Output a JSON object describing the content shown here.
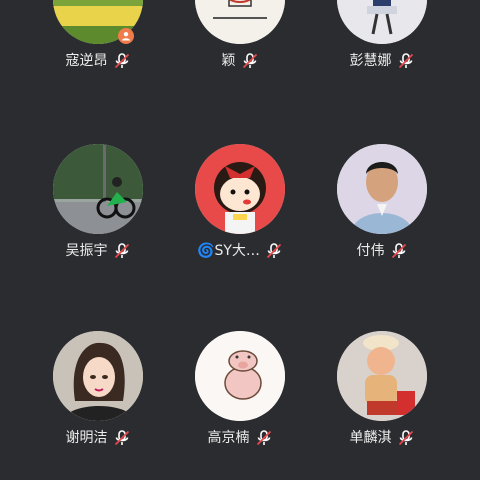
{
  "participants": [
    {
      "name": "寇逆昂",
      "muted": true,
      "host": true,
      "avatar": "landscape-field"
    },
    {
      "name": "颖",
      "muted": true,
      "host": false,
      "avatar": "drawing"
    },
    {
      "name": "彭慧娜",
      "muted": true,
      "host": false,
      "avatar": "person-photo"
    },
    {
      "name": "吴振宇",
      "muted": true,
      "host": false,
      "avatar": "motorcycle-photo"
    },
    {
      "name": "🌀SY大…",
      "muted": true,
      "host": false,
      "avatar": "cartoon-girl"
    },
    {
      "name": "付伟",
      "muted": true,
      "host": false,
      "avatar": "man-portrait"
    },
    {
      "name": "谢明洁",
      "muted": true,
      "host": false,
      "avatar": "cartoon-woman"
    },
    {
      "name": "高京楠",
      "muted": true,
      "host": false,
      "avatar": "cartoon-pig"
    },
    {
      "name": "单麟淇",
      "muted": true,
      "host": false,
      "avatar": "baby-photo"
    }
  ],
  "colors": {
    "background": "#2b2c2f",
    "name_text": "#ececec",
    "mute_icon": "#ffffff",
    "mute_slash": "#e5484d",
    "host_badge": "#f07b4b"
  }
}
